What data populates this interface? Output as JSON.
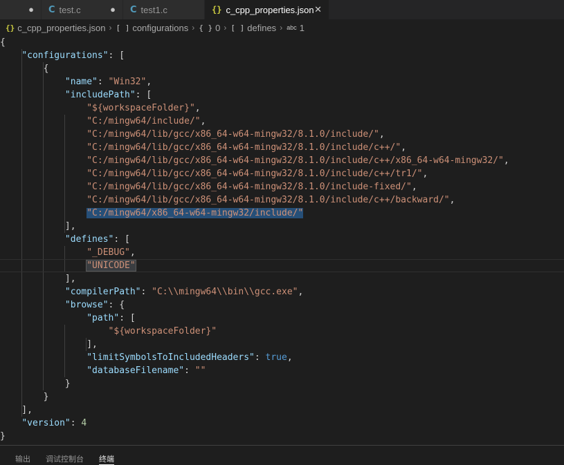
{
  "tabs": [
    {
      "label": "test.c",
      "icon": "c-file-icon",
      "glyph": "C",
      "control": "●",
      "active": false
    },
    {
      "label": "test1.c",
      "icon": "c-file-icon",
      "glyph": "C",
      "control": "●",
      "active": false
    },
    {
      "label": "c_cpp_properties.json",
      "icon": "json-file-icon",
      "glyph": "{}",
      "control": "✕",
      "active": true
    }
  ],
  "breadcrumb": [
    {
      "glyph": "{}",
      "label": "c_cpp_properties.json"
    },
    {
      "glyph": "[ ]",
      "label": "configurations"
    },
    {
      "glyph": "{ }",
      "label": "0"
    },
    {
      "glyph": "[ ]",
      "label": "defines"
    },
    {
      "glyph": "abc",
      "label": "1"
    }
  ],
  "code": {
    "configurations_key": "\"configurations\"",
    "name_key": "\"name\"",
    "name_value": "\"Win32\"",
    "includePath_key": "\"includePath\"",
    "include_paths": [
      "\"${workspaceFolder}\"",
      "\"C:/mingw64/include/\"",
      "\"C:/mingw64/lib/gcc/x86_64-w64-mingw32/8.1.0/include/\"",
      "\"C:/mingw64/lib/gcc/x86_64-w64-mingw32/8.1.0/include/c++/\"",
      "\"C:/mingw64/lib/gcc/x86_64-w64-mingw32/8.1.0/include/c++/x86_64-w64-mingw32/\"",
      "\"C:/mingw64/lib/gcc/x86_64-w64-mingw32/8.1.0/include/c++/tr1/\"",
      "\"C:/mingw64/lib/gcc/x86_64-w64-mingw32/8.1.0/include-fixed/\"",
      "\"C:/mingw64/lib/gcc/x86_64-w64-mingw32/8.1.0/include/c++/backward/\"",
      "\"C:/mingw64/x86_64-w64-mingw32/include/\""
    ],
    "defines_key": "\"defines\"",
    "defines": [
      "\"_DEBUG\"",
      "\"UNICODE\""
    ],
    "compilerPath_key": "\"compilerPath\"",
    "compilerPath_value": "\"C:\\\\mingw64\\\\bin\\\\gcc.exe\"",
    "browse_key": "\"browse\"",
    "path_key": "\"path\"",
    "browse_path": "\"${workspaceFolder}\"",
    "limitSymbols_key": "\"limitSymbolsToIncludedHeaders\"",
    "limitSymbols_value": "true",
    "databaseFilename_key": "\"databaseFilename\"",
    "databaseFilename_value": "\"\"",
    "version_key": "\"version\"",
    "version_value": "4"
  },
  "panel_tabs": [
    "输出",
    "调试控制台",
    "终端"
  ],
  "colors": {
    "editor_bg": "#1e1e1e",
    "json_key": "#9cdcfe",
    "json_string": "#ce9178",
    "json_number": "#b5cea8",
    "json_boolean": "#569cd6",
    "selection": "#264f78"
  }
}
